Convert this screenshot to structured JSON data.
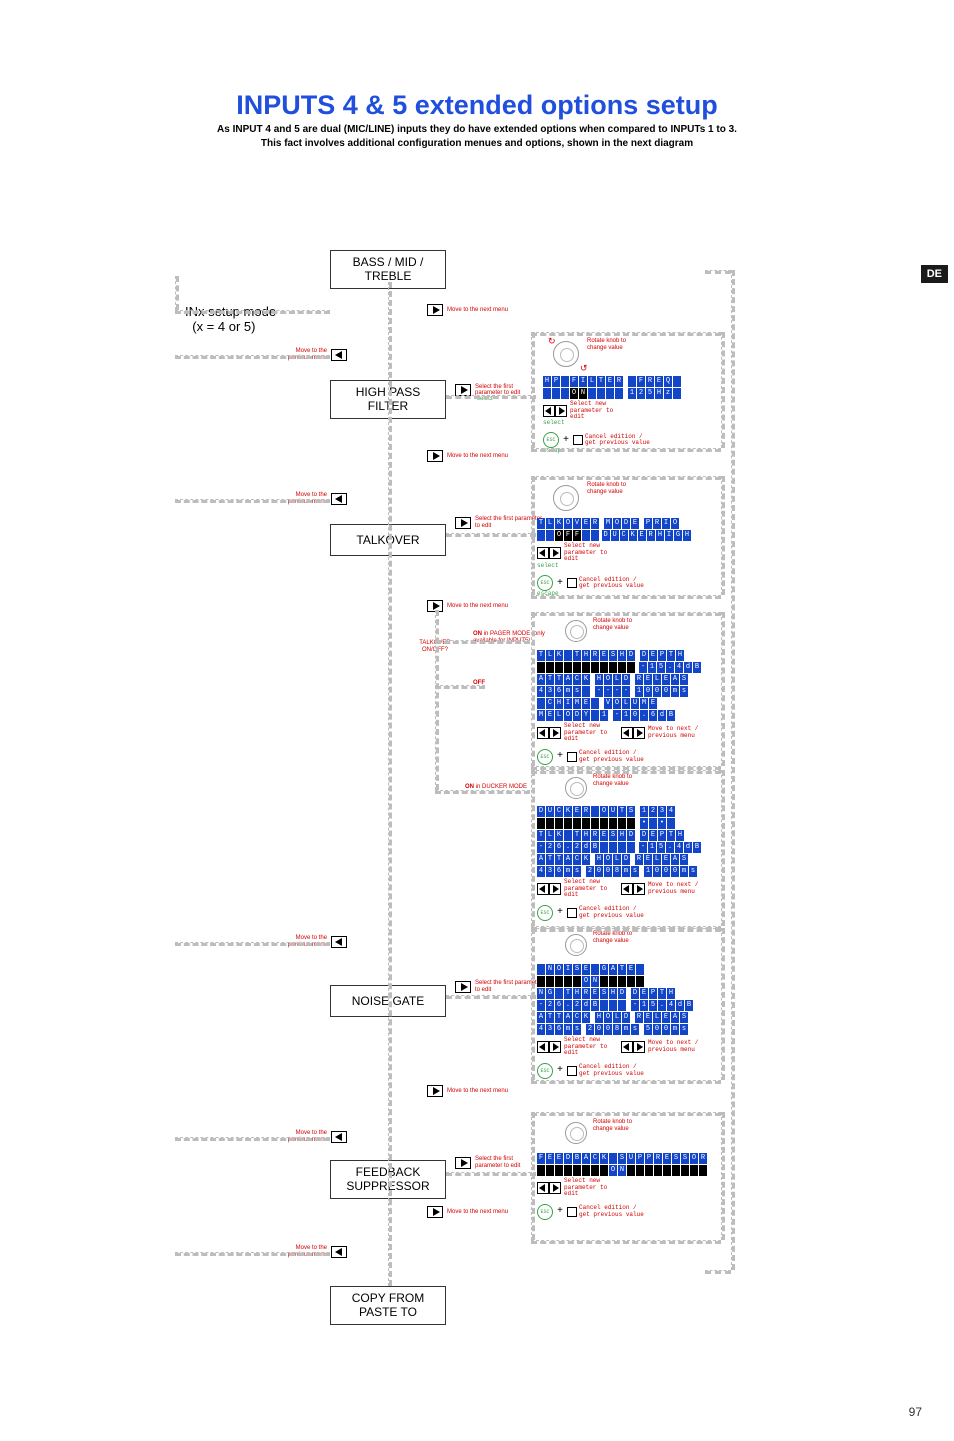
{
  "locale_tab": "DE",
  "page_number": "97",
  "title": "INPUTS 4 & 5 extended options setup",
  "subtitle_line1": "As INPUT 4 and 5 are dual (MIC/LINE) inputs they do have extended options when compared to INPUTs 1 to 3.",
  "subtitle_line2": "This fact involves additional configuration menues and options, shown in the next diagram",
  "entry_label_l1": "INx setup mode",
  "entry_label_l2": "(x = 4 or 5)",
  "menus": {
    "bass": "BASS / MID / TREBLE",
    "hpf": "HIGH PASS FILTER",
    "talkover": "TALKOVER",
    "noisegate": "NOISE GATE",
    "feedback": "FEEDBACK SUPPRESSOR",
    "copy": "COPY FROM PASTE TO"
  },
  "hints": {
    "move_prev": "Move to the previous menu",
    "move_next": "Move to the next menu",
    "select_first": "Select the first parameter to edit",
    "select_first_short": "Select the first parameter to edit",
    "rotate_knob": "Rotate knob to change value",
    "select_new": "Select new parameter to edit",
    "move_next_prev": "Move to next / previous menu",
    "cancel": "Cancel edition / get previous value",
    "on_pager": "ON in PAGER MODE (only available for INPUT5)",
    "on_ducker": "ON in DUCKER MODE",
    "talkover_onoff": "TALKOVER ON/OFF?",
    "off": "OFF",
    "escape": "escape",
    "select": "select"
  },
  "chart_data": {
    "type": "flowchart",
    "entry": "INx setup mode (x = 4 or 5)",
    "main_nodes": [
      "BASS / MID / TREBLE",
      "HIGH PASS FILTER",
      "TALKOVER",
      "NOISE GATE",
      "FEEDBACK SUPPRESSOR",
      "COPY FROM PASTE TO"
    ],
    "vertical_nav": {
      "next_menu_label": "Move to the next menu",
      "prev_menu_label": "Move to the previous menu"
    },
    "horizontal_nav_to_edit_label": "Select the first parameter to edit",
    "edit_common_controls": {
      "knob": "Rotate knob to change value",
      "prev_next": "Select new parameter to edit",
      "escape_plus_stop": "Cancel edition / get previous value"
    },
    "detail_panels": {
      "HIGH PASS FILTER": {
        "rows": [
          {
            "labels": [
              "HP FILTER",
              "FREQ"
            ],
            "values": [
              "ON",
              "125Hz"
            ]
          }
        ]
      },
      "TALKOVER": {
        "rows": [
          {
            "labels": [
              "TLKOVER",
              "MODE",
              "PRIO"
            ],
            "values": [
              "OFF",
              "DUCKER",
              "HIGH"
            ]
          }
        ],
        "branch_condition": "TALKOVER ON/OFF?",
        "branches": {
          "OFF": null,
          "ON in PAGER MODE (only available for INPUT5)": {
            "rows": [
              {
                "labels": [
                  "TLK THRESHD",
                  "DEPTH"
                ],
                "values": [
                  "",
                  "-15.4dB"
                ]
              },
              {
                "labels": [
                  "ATTACK",
                  "HOLD",
                  "RELEAS"
                ],
                "values": [
                  "436ms",
                  "----",
                  "1000ms"
                ]
              },
              {
                "labels": [
                  "CHIME",
                  "VOLUME"
                ],
                "values": [
                  "MELODY 1",
                  "-10.6dB"
                ]
              }
            ],
            "extra_nav": "Move to next / previous menu"
          },
          "ON in DUCKER MODE": {
            "rows": [
              {
                "labels": [
                  "DUCKER OUTS"
                ],
                "values": [
                  "1 2 3 4",
                  "• •"
                ]
              },
              {
                "labels": [
                  "TLK THRESHD",
                  "DEPTH"
                ],
                "values": [
                  "-26.2dB",
                  "-15.4dB"
                ]
              },
              {
                "labels": [
                  "ATTACK",
                  "HOLD",
                  "RELEAS"
                ],
                "values": [
                  "436ms",
                  "2008ms",
                  "1000ms"
                ]
              }
            ],
            "extra_nav": "Move to next / previous menu"
          }
        }
      },
      "NOISE GATE": {
        "rows": [
          {
            "labels": [
              "NOISE GATE"
            ],
            "values": [
              "ON"
            ]
          },
          {
            "labels": [
              "NG THRESHD",
              "DEPTH"
            ],
            "values": [
              "-26.2dB",
              "-15.4dB"
            ]
          },
          {
            "labels": [
              "ATTACK",
              "HOLD",
              "RELEAS"
            ],
            "values": [
              "436ms",
              "2008ms",
              "500ms"
            ]
          }
        ],
        "extra_nav": "Move to next / previous menu"
      },
      "FEEDBACK SUPPRESSOR": {
        "rows": [
          {
            "labels": [
              "FEEDBACK SUPPRESSOR"
            ],
            "values": [
              "ON"
            ]
          }
        ]
      }
    }
  }
}
